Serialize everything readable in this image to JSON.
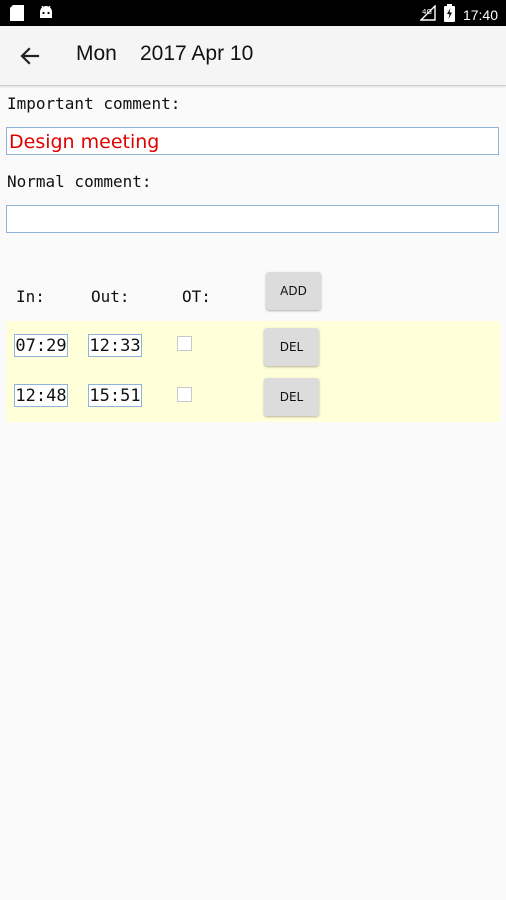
{
  "status_bar": {
    "time": "17:40",
    "left_icons": [
      "sd-card-icon",
      "android-icon"
    ],
    "right_icons": [
      "signal-icon",
      "battery-icon"
    ]
  },
  "app_bar": {
    "back_icon": "arrow-left-icon",
    "day": "Mon",
    "date": "2017 Apr 10"
  },
  "important_comment": {
    "label": "Important comment:",
    "value": "Design meeting",
    "value_color": "#e00000"
  },
  "normal_comment": {
    "label": "Normal comment:",
    "value": ""
  },
  "table": {
    "headers": {
      "in": "In:",
      "out": "Out:",
      "ot": "OT:"
    },
    "add_label": "ADD",
    "row_bg_color": "#ffffd9",
    "rows": [
      {
        "in": "07:29",
        "out": "12:33",
        "ot": false,
        "del_label": "DEL"
      },
      {
        "in": "12:48",
        "out": "15:51",
        "ot": false,
        "del_label": "DEL"
      }
    ]
  }
}
